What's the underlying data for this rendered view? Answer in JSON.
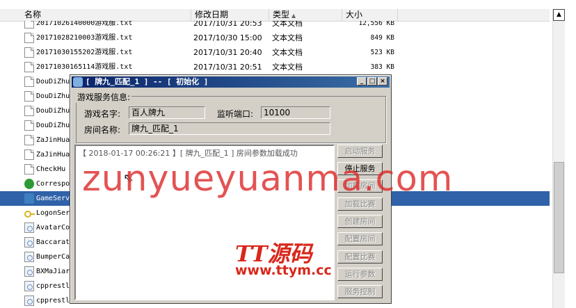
{
  "explorer": {
    "columns": {
      "name": "名称",
      "date": "修改日期",
      "type": "类型",
      "size": "大小"
    },
    "rows": [
      {
        "name": "20171026140000游戏服.txt",
        "date": "2017/10/31 20:53",
        "type": "文本文档",
        "size": "12,556 KB",
        "icon": "text-file-icon"
      },
      {
        "name": "20171028210003游戏服.txt",
        "date": "2017/10/30 15:00",
        "type": "文本文档",
        "size": "849 KB",
        "icon": "text-file-icon"
      },
      {
        "name": "20171030155202游戏服.txt",
        "date": "2017/10/31 20:40",
        "type": "文本文档",
        "size": "523 KB",
        "icon": "text-file-icon"
      },
      {
        "name": "20171030165114游戏服.txt",
        "date": "2017/10/31 20:51",
        "type": "文本文档",
        "size": "383 KB",
        "icon": "text-file-icon"
      },
      {
        "name": "DouDiZhu",
        "icon": "text-file-icon"
      },
      {
        "name": "DouDiZhu",
        "icon": "text-file-icon"
      },
      {
        "name": "DouDiZhu",
        "icon": "text-file-icon"
      },
      {
        "name": "DouDiZhu",
        "icon": "text-file-icon"
      },
      {
        "name": "ZaJinHua",
        "icon": "text-file-icon"
      },
      {
        "name": "ZaJinHua",
        "icon": "text-file-icon"
      },
      {
        "name": "CheckHu",
        "icon": "text-file-icon"
      },
      {
        "name": "Correspo",
        "icon": "tree-app-icon"
      },
      {
        "name": "GameServ",
        "icon": "server-app-icon"
      },
      {
        "name": "LogonSer",
        "icon": "key-icon"
      },
      {
        "name": "AvatarCo",
        "icon": "dll-file-icon"
      },
      {
        "name": "Baccarat",
        "icon": "dll-file-icon"
      },
      {
        "name": "BumperCa",
        "icon": "dll-file-icon"
      },
      {
        "name": "BXMaJiar",
        "icon": "dll-file-icon"
      },
      {
        "name": "cpprestl",
        "icon": "dll-file-icon"
      },
      {
        "name": "cpprestl",
        "icon": "dll-file-icon"
      }
    ]
  },
  "dialog": {
    "title": "[ 牌九_匹配_1 ] -- [ 初始化 ]",
    "group_label": "游戏服务信息:",
    "game_name_label": "游戏名字:",
    "game_name_value": "百人牌九",
    "port_label": "监听端口:",
    "port_value": "10100",
    "room_name_label": "房间名称:",
    "room_name_value": "牌九_匹配_1",
    "log": "【 2018-01-17 00:26:21 】[ 牌九_匹配_1 ] 房间参数加载成功",
    "buttons": [
      "启动服务",
      "停止服务",
      "加载房间",
      "加载比赛",
      "创建房间",
      "配置房间",
      "配置比赛",
      "运行参数",
      "服务控制"
    ]
  },
  "watermark": {
    "big": "zunyueyuanma.com",
    "logo": "TT源码",
    "url": "www.ttym.cc"
  }
}
